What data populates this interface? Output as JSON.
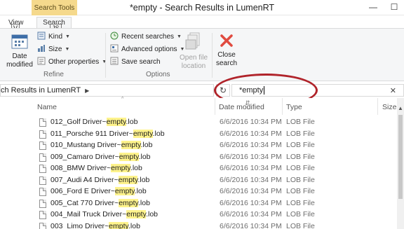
{
  "window": {
    "title": "*empty - Search Results in LumenRT",
    "context_tab": "Search Tools",
    "minimize": "—",
    "maximize": "☐"
  },
  "tabs": {
    "view": "View",
    "search": "Search",
    "keytip_view": "V",
    "keytip_search": "JS"
  },
  "ribbon": {
    "date_modified": "Date modified",
    "kind": "Kind",
    "size": "Size",
    "other_properties": "Other properties",
    "refine_label": "Refine",
    "recent_searches": "Recent searches",
    "advanced_options": "Advanced options",
    "save_search": "Save search",
    "options_label": "Options",
    "open_file_location": "Open file location",
    "close_search": "Close search"
  },
  "address": {
    "path": "ch Results in LumenRT"
  },
  "search": {
    "query": "*empty",
    "clear": "✕"
  },
  "columns": {
    "name": "Name",
    "date_modified": "Date modified",
    "type": "Type",
    "size": "Size"
  },
  "files": [
    {
      "prefix": "012_Golf Driver~",
      "match": "empty",
      "ext": ".lob",
      "date": "6/6/2016 10:34 PM",
      "type": "LOB File"
    },
    {
      "prefix": "011_Porsche 911 Driver~",
      "match": "empty",
      "ext": ".lob",
      "date": "6/6/2016 10:34 PM",
      "type": "LOB File"
    },
    {
      "prefix": "010_Mustang Driver~",
      "match": "empty",
      "ext": ".lob",
      "date": "6/6/2016 10:34 PM",
      "type": "LOB File"
    },
    {
      "prefix": "009_Camaro Driver~",
      "match": "empty",
      "ext": ".lob",
      "date": "6/6/2016 10:34 PM",
      "type": "LOB File"
    },
    {
      "prefix": "008_BMW Driver~",
      "match": "empty",
      "ext": ".lob",
      "date": "6/6/2016 10:34 PM",
      "type": "LOB File"
    },
    {
      "prefix": "007_Audi A4 Driver~",
      "match": "empty",
      "ext": ".lob",
      "date": "6/6/2016 10:34 PM",
      "type": "LOB File"
    },
    {
      "prefix": "006_Ford E Driver~",
      "match": "empty",
      "ext": ".lob",
      "date": "6/6/2016 10:34 PM",
      "type": "LOB File"
    },
    {
      "prefix": "005_Cat 770 Driver~",
      "match": "empty",
      "ext": ".lob",
      "date": "6/6/2016 10:34 PM",
      "type": "LOB File"
    },
    {
      "prefix": "004_Mail Truck Driver~",
      "match": "empty",
      "ext": ".lob",
      "date": "6/6/2016 10:34 PM",
      "type": "LOB File"
    },
    {
      "prefix": "003_Limo Driver~",
      "match": "empty",
      "ext": ".lob",
      "date": "6/6/2016 10:34 PM",
      "type": "LOB File"
    }
  ],
  "colors": {
    "context_tab": "#f5d98c",
    "highlight": "#fef38c",
    "annotation": "#b0232a",
    "close_x": "#e04a3f"
  },
  "icons": {
    "date_modified": "calendar-icon",
    "kind": "kind-icon",
    "size": "size-icon",
    "other_properties": "properties-icon",
    "recent_searches": "recent-searches-icon",
    "advanced_options": "advanced-options-icon",
    "save_search": "save-icon",
    "open_file_location": "folder-icon",
    "close_search": "close-icon"
  }
}
